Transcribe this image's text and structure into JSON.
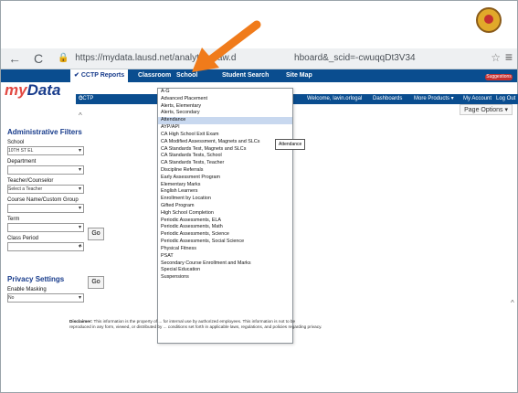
{
  "browser": {
    "url": "https://mydata.lausd.net/analytics/saw.d",
    "url_tail": "hboard&_scid=-cwuqqDt3V34"
  },
  "top_nav": [
    "CCTP Reports",
    "Classroom",
    "School",
    "Student Search",
    "Site Map"
  ],
  "brand": {
    "logo_my": "my",
    "logo_data": "Data"
  },
  "subnav_left": "CCTP Reports",
  "right_links": [
    "Welcome, lavin.orlogal",
    "Dashboards",
    "More Products ▾",
    "My Account",
    "Log Out"
  ],
  "page_options": "Page Options ▾",
  "left_panel": {
    "admin_title": "Administrative Filters",
    "school_label": "School",
    "school_value": "10TH ST EL",
    "department_label": "Department",
    "teacher_label": "Teacher/Counselor",
    "teacher_value": "Select a Teacher",
    "course_label": "Course Name/Custom Group",
    "term_label": "Term",
    "class_label": "Class Period",
    "go_label": "Go",
    "privacy_title": "Privacy Settings",
    "masking_label": "Enable Masking",
    "masking_value": "No"
  },
  "dropdown": {
    "items": [
      "A-G",
      "Advanced Placement",
      "Alerts, Elementary",
      "Alerts, Secondary",
      "Attendance",
      "AYP/API",
      "CA High School Exit Exam",
      "CA Modified Assessment, Magnets and SLCs",
      "CA Standards Test, Magnets and SLCs",
      "CA Standards Tests, School",
      "CA Standards Tests, Teacher",
      "Discipline Referrals",
      "Early Assessment Program",
      "Elementary Marks",
      "English Learners",
      "Enrollment by Location",
      "Gifted Program",
      "High School Completion",
      "Periodic Assessments, ELA",
      "Periodic Assessments, Math",
      "Periodic Assessments, Science",
      "Periodic Assessments, Social Science",
      "Physical Fitness",
      "PSAT",
      "Secondary Course Enrollment and Marks",
      "Special Education",
      "Suspensions"
    ],
    "highlighted": "Attendance",
    "tooltip": "Attendance"
  },
  "disclaimer": {
    "label": "Disclaimer:",
    "line1": "This information is the property of ... for internal use by authorized employees. This information is not to be",
    "line2": "reproduced in any form, viewed, or distributed by ... conditions set forth in applicable laws, regulations, and policies regarding privacy."
  },
  "colors": {
    "nav_bg": "#0a4d8f",
    "highlight": "#c8d8ef",
    "arrow": "#f07b1b",
    "suggestions": "#c43030"
  }
}
